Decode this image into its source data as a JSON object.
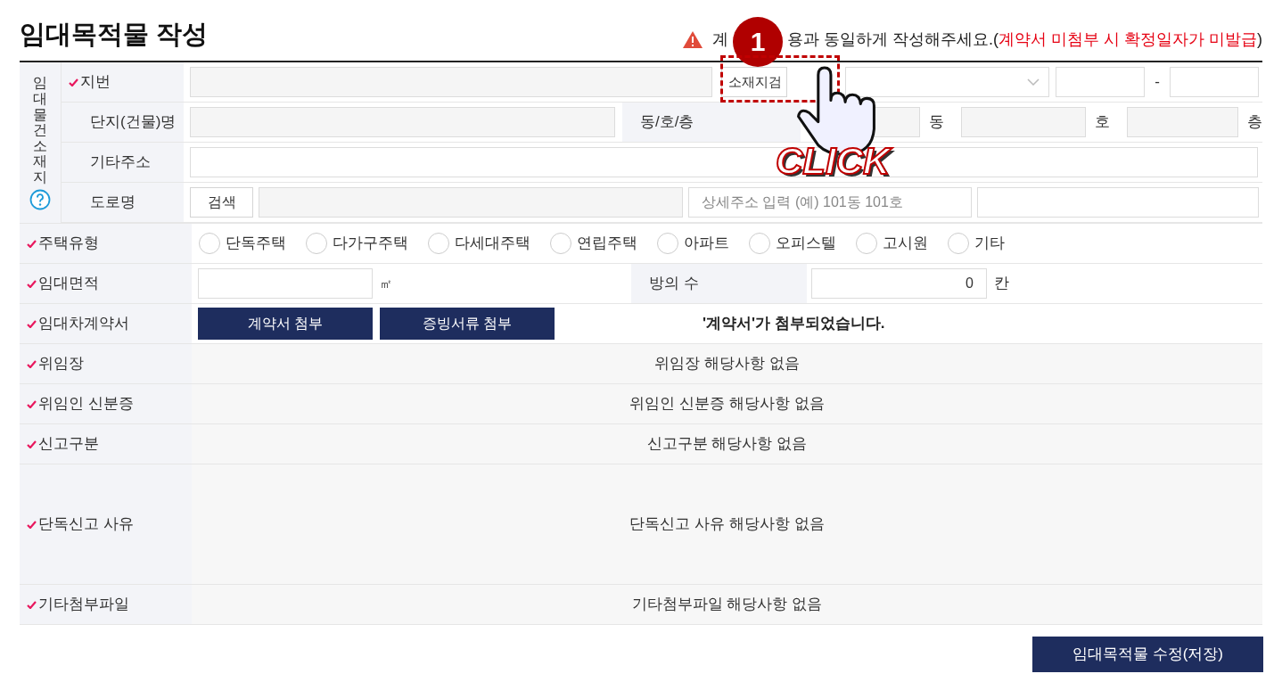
{
  "title": "임대목적물 작성",
  "notice": {
    "parts": [
      "계",
      "용과 동일하게 작성해주세요.("
    ],
    "warning": "계약서 미첨부 시 확정일자가 미발급",
    "close": ")"
  },
  "location": {
    "label": "임대물건소재지",
    "rows": [
      {
        "kind": "lot",
        "label": "지번",
        "required": true,
        "search_button": "소재지검",
        "dash": "-"
      },
      {
        "kind": "complex",
        "label": "단지(건물)명",
        "required": false,
        "sub_label": "동/호/층",
        "units": [
          "동",
          "호",
          "층"
        ]
      },
      {
        "kind": "etc",
        "label": "기타주소",
        "required": false
      },
      {
        "kind": "road",
        "label": "도로명",
        "required": false,
        "search_button": "검색",
        "detail_placeholder": "상세주소 입력 (예) 101동 101호"
      }
    ]
  },
  "rows": [
    {
      "kind": "radios",
      "label": "주택유형",
      "required": true,
      "options": [
        {
          "label": "단독주택",
          "selected": false
        },
        {
          "label": "다가구주택",
          "selected": false
        },
        {
          "label": "다세대주택",
          "selected": false
        },
        {
          "label": "연립주택",
          "selected": false
        },
        {
          "label": "아파트",
          "selected": false
        },
        {
          "label": "오피스텔",
          "selected": false
        },
        {
          "label": "고시원",
          "selected": false
        },
        {
          "label": "기타",
          "selected": false
        }
      ]
    },
    {
      "kind": "area",
      "label": "임대면적",
      "required": true,
      "unit": "㎡",
      "sub_label": "방의 수",
      "rooms": "0",
      "rooms_unit": "칸"
    },
    {
      "kind": "attach",
      "label": "임대차계약서",
      "required": true,
      "buttons": [
        "계약서 첨부",
        "증빙서류 첨부"
      ],
      "message": "'계약서'가 첨부되었습니다."
    },
    {
      "kind": "info",
      "label": "위임장",
      "required": true,
      "message": "위임장 해당사항 없음"
    },
    {
      "kind": "info",
      "label": "위임인 신분증",
      "required": true,
      "message": "위임인 신분증 해당사항 없음"
    },
    {
      "kind": "info",
      "label": "신고구분",
      "required": true,
      "message": "신고구분 해당사항 없음"
    },
    {
      "kind": "memo",
      "label": "단독신고 사유",
      "required": true,
      "message": "단독신고 사유 해당사항 없음"
    },
    {
      "kind": "info",
      "label": "기타첨부파일",
      "required": true,
      "message": "기타첨부파일 해당사항 없음"
    }
  ],
  "save_button": "임대목적물 수정(저장)",
  "overlay": {
    "badge": "1",
    "text": "CLICK"
  }
}
